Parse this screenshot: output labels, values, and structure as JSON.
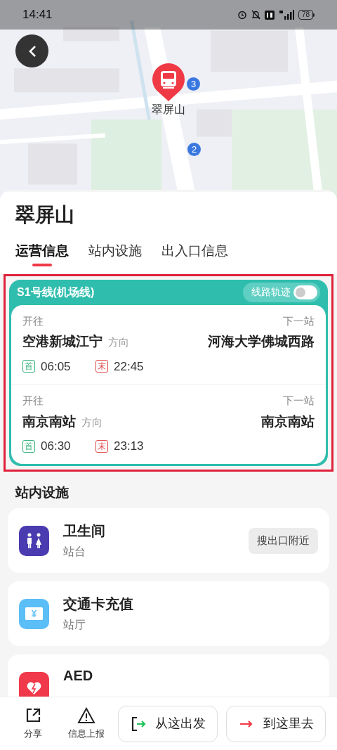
{
  "status_bar": {
    "time": "14:41",
    "battery": "78"
  },
  "map": {
    "marker_label": "翠屏山",
    "exits": [
      "3",
      "2"
    ]
  },
  "station": {
    "title": "翠屏山"
  },
  "tabs": [
    {
      "label": "运营信息",
      "selected": true
    },
    {
      "label": "站内设施",
      "selected": false
    },
    {
      "label": "出入口信息",
      "selected": false
    }
  ],
  "line": {
    "name": "S1号线(机场线)",
    "toggle_label": "线路轨迹",
    "toggle_on": false,
    "highlighted": true,
    "directions": [
      {
        "heading_label": "开往",
        "destination": "空港新城江宁",
        "direction_suffix": "方向",
        "next_label": "下一站",
        "next_station": "河海大学佛城西路",
        "first_badge": "首",
        "first_time": "06:05",
        "last_badge": "末",
        "last_time": "22:45"
      },
      {
        "heading_label": "开往",
        "destination": "南京南站",
        "direction_suffix": "方向",
        "next_label": "下一站",
        "next_station": "南京南站",
        "first_badge": "首",
        "first_time": "06:30",
        "last_badge": "末",
        "last_time": "23:13"
      }
    ]
  },
  "facilities_heading": "站内设施",
  "facilities": [
    {
      "kind": "toilet",
      "name": "卫生间",
      "location": "站台",
      "action": "搜出口附近",
      "color": "#4b3bb0"
    },
    {
      "kind": "card",
      "name": "交通卡充值",
      "location": "站厅",
      "color": "#5bbef7"
    },
    {
      "kind": "aed",
      "name": "AED",
      "color": "#f0394a"
    }
  ],
  "bottom_bar": {
    "share": "分享",
    "report": "信息上报",
    "depart": "从这出发",
    "arrive": "到这里去"
  }
}
